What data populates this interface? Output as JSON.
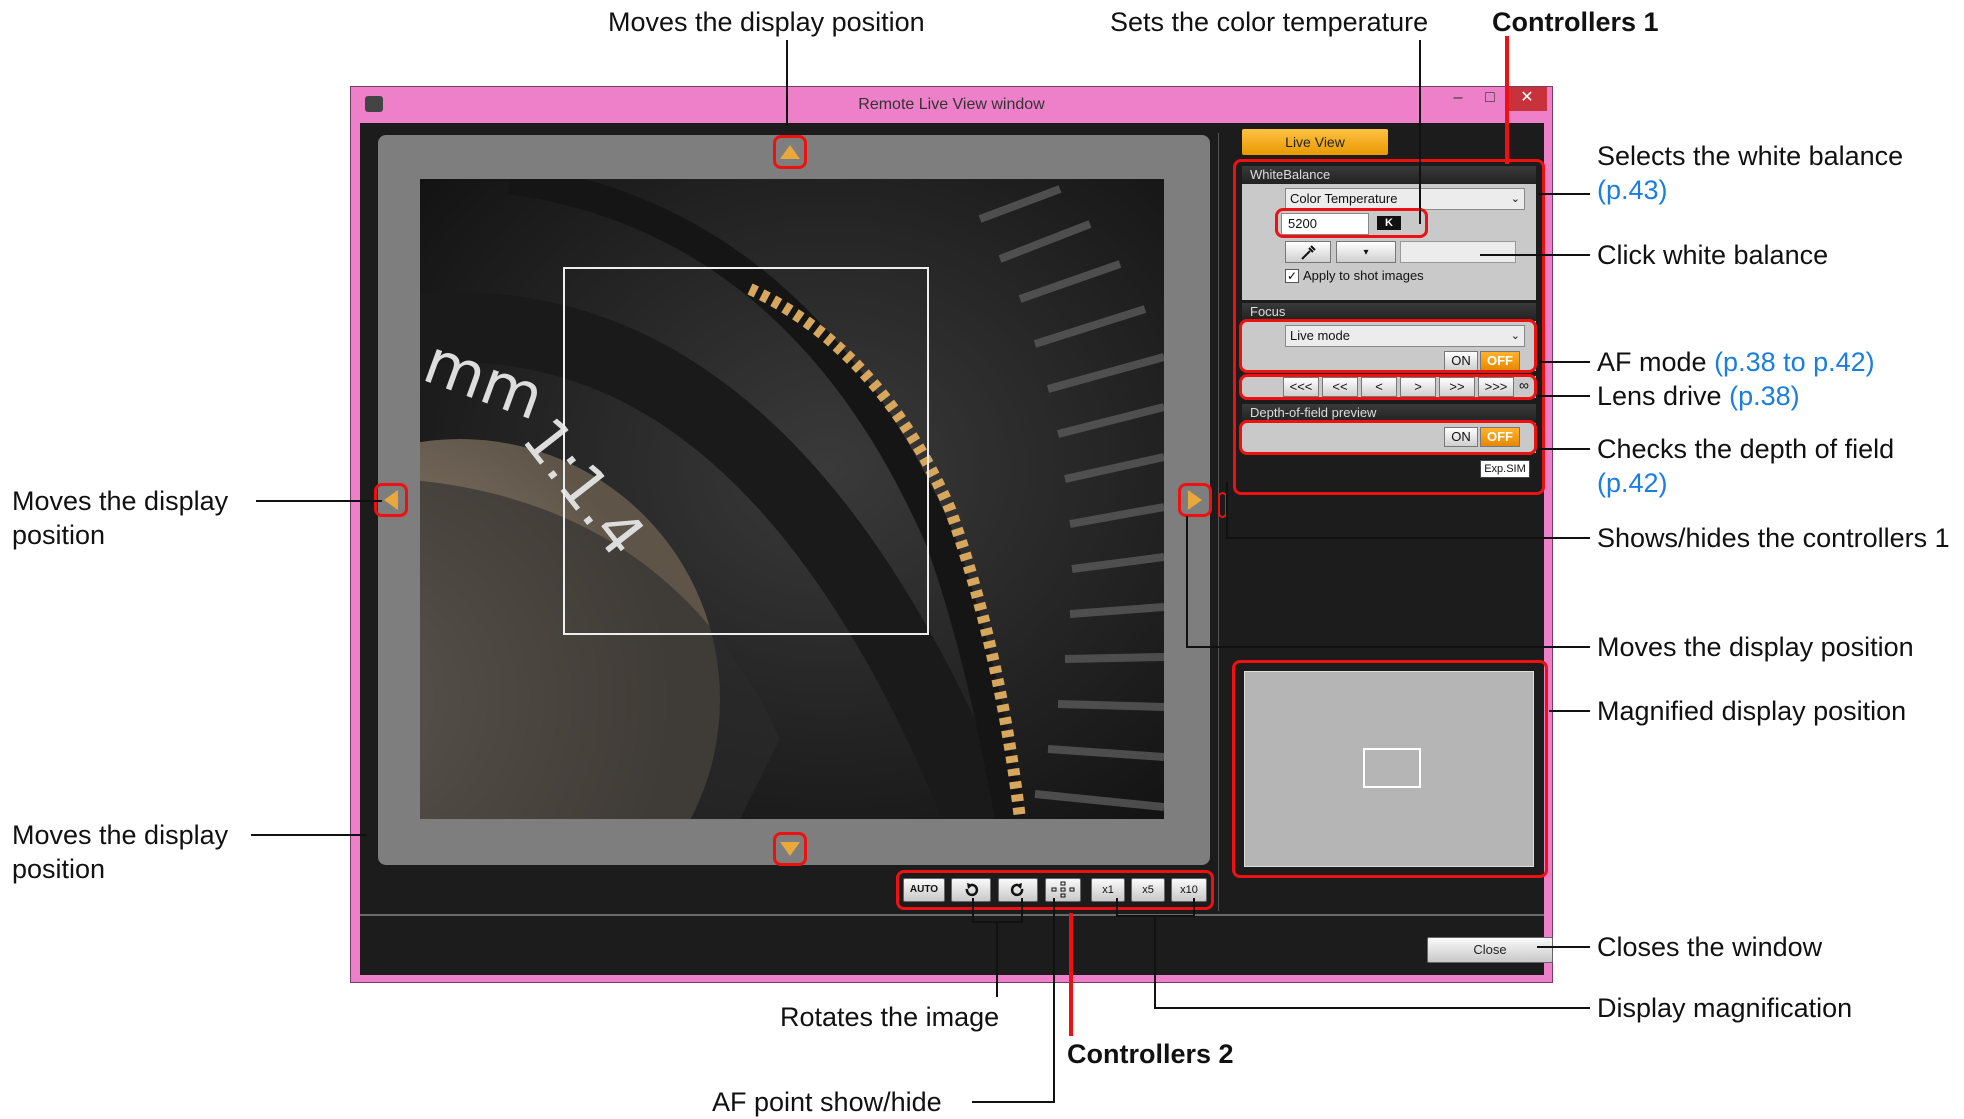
{
  "annotations": {
    "top_display": "Moves the display position",
    "color_temp": "Sets the color temperature",
    "controllers1": "Controllers 1",
    "white_balance": "Selects the white balance",
    "white_balance_ref": "(p.43)",
    "click_wb": "Click white balance",
    "af_mode": "AF mode",
    "af_mode_ref": "(p.38 to p.42)",
    "lens_drive": "Lens drive",
    "lens_drive_ref": "(p.38)",
    "dof": "Checks the depth of field",
    "dof_ref": "(p.42)",
    "show_hide": "Shows/hides the controllers 1",
    "right_display": "Moves the display position",
    "magnified_pos": "Magnified display position",
    "closes": "Closes the window",
    "display_mag": "Display magnification",
    "left_display_1": "Moves the display",
    "left_display_2": "position",
    "bottom_left_display_1": "Moves the display",
    "bottom_left_display_2": "position",
    "rotates": "Rotates the image",
    "controllers2": "Controllers 2",
    "af_point": "AF point show/hide"
  },
  "window": {
    "title": "Remote Live View window",
    "minimize": "–",
    "maximize": "□",
    "close": "✕"
  },
  "panel": {
    "live_view_tab": "Live View",
    "white_balance_header": "WhiteBalance",
    "wb_select": "Color Temperature",
    "color_temp_value": "5200",
    "kelvin": "K",
    "apply_label": "Apply to shot images",
    "focus_header": "Focus",
    "focus_mode": "Live mode",
    "on": "ON",
    "off": "OFF",
    "lens_buttons": [
      "<<<",
      "<<",
      "<",
      ">",
      ">>",
      ">>>"
    ],
    "infinity": "∞",
    "dof_header": "Depth-of-field preview",
    "dof_on": "ON",
    "dof_off": "OFF",
    "exp_sim": "Exp.SIM"
  },
  "toolbar": {
    "auto_rotate": "AUTO",
    "zoom_1": "x1",
    "zoom_5": "x5",
    "zoom_10": "x10"
  },
  "lens_text": {
    "mm": "mm",
    "aperture": "1:1.4"
  },
  "footer": {
    "close_button": "Close"
  }
}
